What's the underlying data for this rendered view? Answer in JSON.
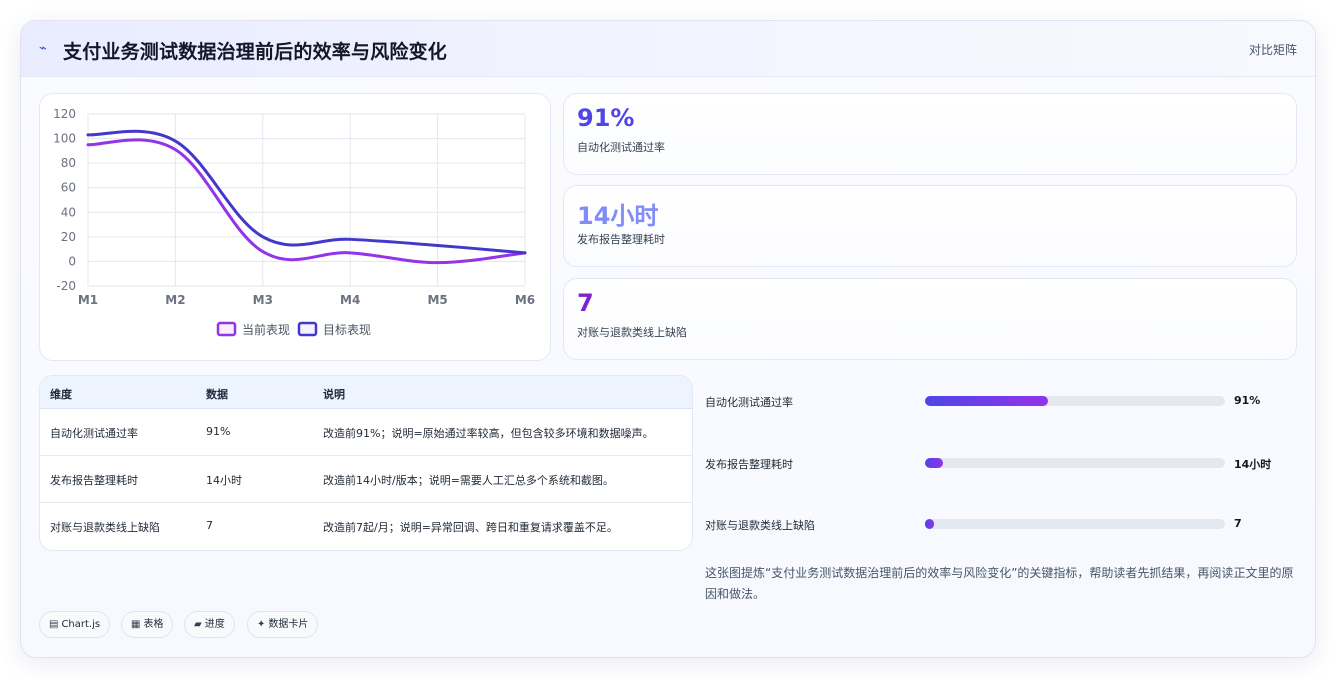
{
  "header": {
    "logo_icon": "⌁",
    "title": "支付业务测试数据治理前后的效率与风险变化",
    "tag": "对比矩阵"
  },
  "chart_data": {
    "type": "line",
    "categories": [
      "M1",
      "M2",
      "M3",
      "M4",
      "M5",
      "M6"
    ],
    "yticks": [
      120,
      100,
      80,
      60,
      40,
      20,
      0,
      -20
    ],
    "ylim": [
      -20,
      120
    ],
    "grid": true,
    "legend_position": "bottom",
    "series": [
      {
        "name": "当前表现",
        "color": "#9333ea",
        "values": [
          95,
          91,
          8,
          7,
          -1,
          7
        ]
      },
      {
        "name": "目标表现",
        "color": "#4338ca",
        "values": [
          103,
          98,
          20,
          18,
          13,
          7
        ]
      }
    ]
  },
  "kpis": [
    {
      "value": "91%",
      "label": "自动化测试通过率",
      "color": "#4f46e5"
    },
    {
      "value": "14小时",
      "label": "发布报告整理耗时",
      "color": "#818cf8"
    },
    {
      "value": "7",
      "label": "对账与退款类线上缺陷",
      "color": "#7e22ce"
    }
  ],
  "table": {
    "headers": [
      "维度",
      "数据",
      "说明"
    ],
    "rows": [
      [
        "自动化测试通过率",
        "91%",
        "改造前91%；说明=原始通过率较高，但包含较多环境和数据噪声。"
      ],
      [
        "发布报告整理耗时",
        "14小时",
        "改造前14小时/版本；说明=需要人工汇总多个系统和截图。"
      ],
      [
        "对账与退款类线上缺陷",
        "7",
        "改造前7起/月；说明=异常回调、跨日和重复请求覆盖不足。"
      ]
    ]
  },
  "progress": [
    {
      "label": "自动化测试通过率",
      "value": "91%",
      "fraction": 0.41
    },
    {
      "label": "发布报告整理耗时",
      "value": "14小时",
      "fraction": 0.06
    },
    {
      "label": "对账与退款类线上缺陷",
      "value": "7",
      "fraction": 0.03
    }
  ],
  "description": "这张图提炼“支付业务测试数据治理前后的效率与风险变化”的关键指标，帮助读者先抓结果，再阅读正文里的原因和做法。",
  "pills": [
    {
      "icon": "▤",
      "label": "Chart.js"
    },
    {
      "icon": "▦",
      "label": "表格"
    },
    {
      "icon": "▰",
      "label": "进度"
    },
    {
      "icon": "✦",
      "label": "数据卡片"
    }
  ]
}
